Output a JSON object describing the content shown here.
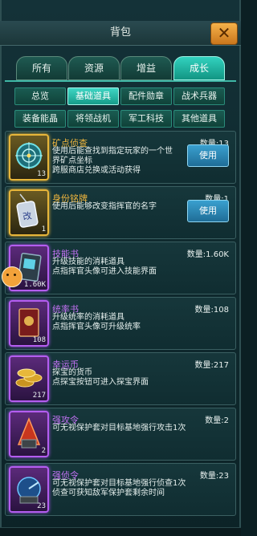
{
  "header": {
    "title": "背包",
    "close_symbol": "✕"
  },
  "tabs": [
    {
      "label": "所有",
      "active": false
    },
    {
      "label": "资源",
      "active": false
    },
    {
      "label": "增益",
      "active": false
    },
    {
      "label": "成长",
      "active": true
    }
  ],
  "subtabs": [
    {
      "label": "总览",
      "active": false
    },
    {
      "label": "基础道具",
      "active": true
    },
    {
      "label": "配件勋章",
      "active": false
    },
    {
      "label": "战术兵器",
      "active": false
    },
    {
      "label": "装备能晶",
      "active": false
    },
    {
      "label": "将领战机",
      "active": false
    },
    {
      "label": "军工科技",
      "active": false
    },
    {
      "label": "其他道具",
      "active": false
    }
  ],
  "items": [
    {
      "name": "矿点侦查",
      "rarity": "gold",
      "quantity": "数量:13",
      "count_badge": "13",
      "desc": "使用后能查找到指定玩家的一个世\n界矿点坐标\n跨服商店兑换或活动获得",
      "use_label": "使用",
      "icon": "radar-target-icon"
    },
    {
      "name": "身份铭牌",
      "rarity": "gold",
      "quantity": "数量:1",
      "count_badge": "1",
      "desc": "使用后能够改变指挥官的名字",
      "use_label": "使用",
      "icon": "dog-tag-icon"
    },
    {
      "name": "技能书",
      "rarity": "purple",
      "quantity": "数量:1.60K",
      "count_badge": "1.60K",
      "desc": "升级技能的消耗道具\n点指挥官头像可进入技能界面",
      "icon": "skill-book-icon"
    },
    {
      "name": "统率书",
      "rarity": "purple",
      "quantity": "数量:108",
      "count_badge": "108",
      "desc": "升级统率的消耗道具\n点指挥官头像可升级统率",
      "icon": "command-book-icon"
    },
    {
      "name": "幸运币",
      "rarity": "purple",
      "quantity": "数量:217",
      "count_badge": "217",
      "desc": "探宝的货币\n点探宝按钮可进入探宝界面",
      "icon": "lucky-coin-icon"
    },
    {
      "name": "强攻令",
      "rarity": "purple",
      "quantity": "数量:2",
      "count_badge": "2",
      "desc": "可无视保护套对目标基地强行攻击1次",
      "icon": "assault-order-icon"
    },
    {
      "name": "强侦令",
      "rarity": "purple",
      "quantity": "数量:23",
      "count_badge": "23",
      "desc": "可无视保护套对目标基地强行侦查1次\n侦查可获知敌军保护套剩余时间",
      "icon": "scout-order-icon"
    }
  ]
}
